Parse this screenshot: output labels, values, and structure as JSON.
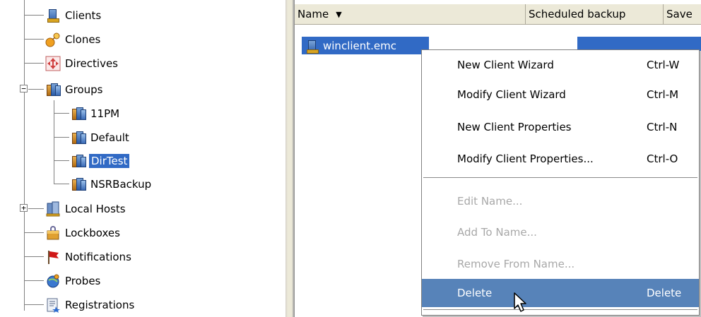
{
  "tree": {
    "items": [
      {
        "label": "Clients",
        "icon": "client-icon"
      },
      {
        "label": "Clones",
        "icon": "clones-icon"
      },
      {
        "label": "Directives",
        "icon": "directives-icon"
      },
      {
        "label": "Groups",
        "icon": "groups-icon",
        "expander": "−"
      },
      {
        "label": "11PM",
        "icon": "group-icon"
      },
      {
        "label": "Default",
        "icon": "group-icon"
      },
      {
        "label": "DirTest",
        "icon": "group-icon",
        "selected": true
      },
      {
        "label": "NSRBackup",
        "icon": "group-icon"
      },
      {
        "label": "Local Hosts",
        "icon": "local-hosts-icon",
        "expander": "+"
      },
      {
        "label": "Lockboxes",
        "icon": "lockbox-icon"
      },
      {
        "label": "Notifications",
        "icon": "notification-flag-icon"
      },
      {
        "label": "Probes",
        "icon": "probe-icon"
      },
      {
        "label": "Registrations",
        "icon": "registrations-icon"
      }
    ]
  },
  "list": {
    "columns": [
      "Name",
      "Scheduled backup",
      "Save"
    ],
    "sort_arrow": "▼",
    "rows": [
      {
        "name": "winclient.emc"
      }
    ]
  },
  "context_menu": {
    "items": [
      {
        "label": "New Client Wizard",
        "shortcut": "Ctrl-W",
        "enabled": true
      },
      {
        "label": "Modify Client Wizard",
        "shortcut": "Ctrl-M",
        "enabled": true
      },
      {
        "label": "New Client Properties",
        "shortcut": "Ctrl-N",
        "enabled": true
      },
      {
        "label": "Modify Client Properties...",
        "shortcut": "Ctrl-O",
        "enabled": true
      },
      {
        "label": "Edit Name...",
        "shortcut": "",
        "enabled": false
      },
      {
        "label": "Add To Name...",
        "shortcut": "",
        "enabled": false
      },
      {
        "label": "Remove From Name...",
        "shortcut": "",
        "enabled": false
      },
      {
        "label": "Delete",
        "shortcut": "Delete",
        "enabled": true,
        "highlighted": true
      }
    ]
  },
  "colors": {
    "selection": "#316ac5",
    "menu_highlight": "#5783b9",
    "disabled_text": "#a8a8a8",
    "header_bg": "#ece9d8"
  }
}
